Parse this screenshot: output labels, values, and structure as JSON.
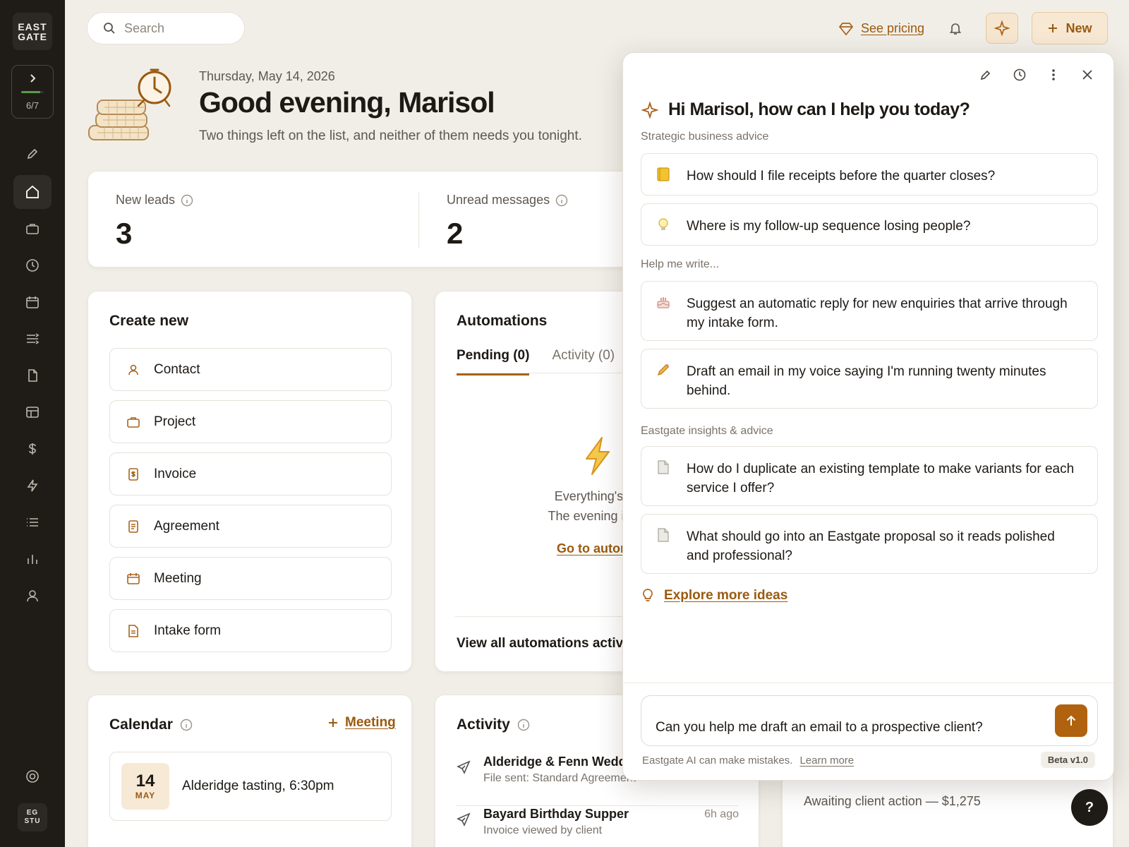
{
  "sidebar": {
    "logo_line1": "EAST",
    "logo_line2": "GATE",
    "progress_label": "6/7",
    "progress_fraction": 0.857,
    "nav": [
      "edit-icon",
      "home-icon",
      "briefcase-icon",
      "clock-icon",
      "calendar-icon",
      "workflow-icon",
      "document-icon",
      "table-icon",
      "dollar-icon",
      "lightning-icon",
      "list-icon",
      "bar-chart-icon",
      "person-icon",
      "settings-ring-icon"
    ],
    "avatar_line1": "EG",
    "avatar_line2": "STU"
  },
  "topbar": {
    "search_placeholder": "Search",
    "see_pricing": "See pricing",
    "new_label": "New"
  },
  "greeting": {
    "date": "Thursday, May 14, 2026",
    "title": "Good evening, Marisol",
    "subtitle": "Two things left on the list, and neither of them needs you tonight."
  },
  "stats": [
    {
      "label": "New leads",
      "value": "3"
    },
    {
      "label": "Unread messages",
      "value": "2"
    }
  ],
  "create_new": {
    "title": "Create new",
    "items": [
      {
        "label": "Contact",
        "icon": "person-icon"
      },
      {
        "label": "Project",
        "icon": "briefcase-icon"
      },
      {
        "label": "Invoice",
        "icon": "invoice-icon"
      },
      {
        "label": "Agreement",
        "icon": "agreement-icon"
      },
      {
        "label": "Meeting",
        "icon": "calendar-icon"
      },
      {
        "label": "Intake form",
        "icon": "form-icon"
      }
    ]
  },
  "automations": {
    "title": "Automations",
    "tab_pending": "Pending (0)",
    "tab_activity": "Activity (0)",
    "empty_line1": "Everything's ap",
    "empty_line2": "The evening is yo",
    "link": "Go to automa",
    "footer": "View all automations activi"
  },
  "calendar": {
    "title": "Calendar",
    "add_label": "Meeting",
    "event": {
      "day": "14",
      "month": "MAY",
      "text": "Alderidge tasting, 6:30pm"
    }
  },
  "activity": {
    "title": "Activity",
    "rows": [
      {
        "name": "Alderidge & Fenn Wedd",
        "sub": "File sent: Standard Agreement",
        "time": ""
      },
      {
        "name": "Bayard Birthday Supper",
        "sub": "Invoice viewed by client",
        "time": "6h ago"
      }
    ]
  },
  "invoices": {
    "status_text": "Awaiting client action — $1,275"
  },
  "help_label": "?",
  "ai_panel": {
    "greeting": "Hi Marisol, how can I help you today?",
    "sections": [
      {
        "label": "Strategic business advice",
        "items": [
          {
            "emoji": "📒",
            "text": "How should I file receipts before the quarter closes?"
          },
          {
            "emoji": "💡",
            "text": "Where is my follow-up sequence losing people?"
          }
        ]
      },
      {
        "label": "Help me write...",
        "items": [
          {
            "emoji": "🎂",
            "text": "Suggest an automatic reply for new enquiries that arrive through my intake form."
          },
          {
            "emoji": "✏️",
            "text": "Draft an email in my voice saying I'm running twenty minutes behind."
          }
        ]
      },
      {
        "label": "Eastgate insights & advice",
        "items": [
          {
            "emoji": "📄",
            "text": "How do I duplicate an existing template to make variants for each service I offer?"
          },
          {
            "emoji": "📄",
            "text": "What should go into an Eastgate proposal so it reads polished and professional?"
          }
        ]
      }
    ],
    "explore": "Explore more ideas",
    "composer_value": "Can you help me draft an email to a prospective client?",
    "disclaimer": "Eastgate AI can make mistakes.",
    "learn_more": "Learn more",
    "beta": "Beta v1.0"
  },
  "colors": {
    "accent": "#a8631a",
    "sidebar_bg": "#1f1c18",
    "page_bg": "#f1eee8"
  }
}
